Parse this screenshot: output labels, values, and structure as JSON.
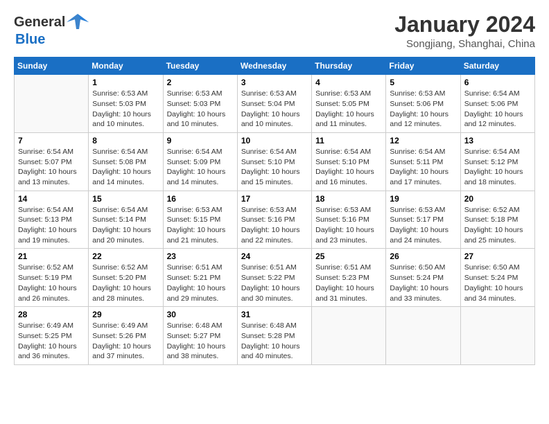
{
  "header": {
    "logo_general": "General",
    "logo_blue": "Blue",
    "month_title": "January 2024",
    "location": "Songjiang, Shanghai, China"
  },
  "days_of_week": [
    "Sunday",
    "Monday",
    "Tuesday",
    "Wednesday",
    "Thursday",
    "Friday",
    "Saturday"
  ],
  "weeks": [
    [
      {
        "day": "",
        "sunrise": "",
        "sunset": "",
        "daylight": ""
      },
      {
        "day": "1",
        "sunrise": "Sunrise: 6:53 AM",
        "sunset": "Sunset: 5:03 PM",
        "daylight": "Daylight: 10 hours and 10 minutes."
      },
      {
        "day": "2",
        "sunrise": "Sunrise: 6:53 AM",
        "sunset": "Sunset: 5:03 PM",
        "daylight": "Daylight: 10 hours and 10 minutes."
      },
      {
        "day": "3",
        "sunrise": "Sunrise: 6:53 AM",
        "sunset": "Sunset: 5:04 PM",
        "daylight": "Daylight: 10 hours and 10 minutes."
      },
      {
        "day": "4",
        "sunrise": "Sunrise: 6:53 AM",
        "sunset": "Sunset: 5:05 PM",
        "daylight": "Daylight: 10 hours and 11 minutes."
      },
      {
        "day": "5",
        "sunrise": "Sunrise: 6:53 AM",
        "sunset": "Sunset: 5:06 PM",
        "daylight": "Daylight: 10 hours and 12 minutes."
      },
      {
        "day": "6",
        "sunrise": "Sunrise: 6:54 AM",
        "sunset": "Sunset: 5:06 PM",
        "daylight": "Daylight: 10 hours and 12 minutes."
      }
    ],
    [
      {
        "day": "7",
        "sunrise": "Sunrise: 6:54 AM",
        "sunset": "Sunset: 5:07 PM",
        "daylight": "Daylight: 10 hours and 13 minutes."
      },
      {
        "day": "8",
        "sunrise": "Sunrise: 6:54 AM",
        "sunset": "Sunset: 5:08 PM",
        "daylight": "Daylight: 10 hours and 14 minutes."
      },
      {
        "day": "9",
        "sunrise": "Sunrise: 6:54 AM",
        "sunset": "Sunset: 5:09 PM",
        "daylight": "Daylight: 10 hours and 14 minutes."
      },
      {
        "day": "10",
        "sunrise": "Sunrise: 6:54 AM",
        "sunset": "Sunset: 5:10 PM",
        "daylight": "Daylight: 10 hours and 15 minutes."
      },
      {
        "day": "11",
        "sunrise": "Sunrise: 6:54 AM",
        "sunset": "Sunset: 5:10 PM",
        "daylight": "Daylight: 10 hours and 16 minutes."
      },
      {
        "day": "12",
        "sunrise": "Sunrise: 6:54 AM",
        "sunset": "Sunset: 5:11 PM",
        "daylight": "Daylight: 10 hours and 17 minutes."
      },
      {
        "day": "13",
        "sunrise": "Sunrise: 6:54 AM",
        "sunset": "Sunset: 5:12 PM",
        "daylight": "Daylight: 10 hours and 18 minutes."
      }
    ],
    [
      {
        "day": "14",
        "sunrise": "Sunrise: 6:54 AM",
        "sunset": "Sunset: 5:13 PM",
        "daylight": "Daylight: 10 hours and 19 minutes."
      },
      {
        "day": "15",
        "sunrise": "Sunrise: 6:54 AM",
        "sunset": "Sunset: 5:14 PM",
        "daylight": "Daylight: 10 hours and 20 minutes."
      },
      {
        "day": "16",
        "sunrise": "Sunrise: 6:53 AM",
        "sunset": "Sunset: 5:15 PM",
        "daylight": "Daylight: 10 hours and 21 minutes."
      },
      {
        "day": "17",
        "sunrise": "Sunrise: 6:53 AM",
        "sunset": "Sunset: 5:16 PM",
        "daylight": "Daylight: 10 hours and 22 minutes."
      },
      {
        "day": "18",
        "sunrise": "Sunrise: 6:53 AM",
        "sunset": "Sunset: 5:16 PM",
        "daylight": "Daylight: 10 hours and 23 minutes."
      },
      {
        "day": "19",
        "sunrise": "Sunrise: 6:53 AM",
        "sunset": "Sunset: 5:17 PM",
        "daylight": "Daylight: 10 hours and 24 minutes."
      },
      {
        "day": "20",
        "sunrise": "Sunrise: 6:52 AM",
        "sunset": "Sunset: 5:18 PM",
        "daylight": "Daylight: 10 hours and 25 minutes."
      }
    ],
    [
      {
        "day": "21",
        "sunrise": "Sunrise: 6:52 AM",
        "sunset": "Sunset: 5:19 PM",
        "daylight": "Daylight: 10 hours and 26 minutes."
      },
      {
        "day": "22",
        "sunrise": "Sunrise: 6:52 AM",
        "sunset": "Sunset: 5:20 PM",
        "daylight": "Daylight: 10 hours and 28 minutes."
      },
      {
        "day": "23",
        "sunrise": "Sunrise: 6:51 AM",
        "sunset": "Sunset: 5:21 PM",
        "daylight": "Daylight: 10 hours and 29 minutes."
      },
      {
        "day": "24",
        "sunrise": "Sunrise: 6:51 AM",
        "sunset": "Sunset: 5:22 PM",
        "daylight": "Daylight: 10 hours and 30 minutes."
      },
      {
        "day": "25",
        "sunrise": "Sunrise: 6:51 AM",
        "sunset": "Sunset: 5:23 PM",
        "daylight": "Daylight: 10 hours and 31 minutes."
      },
      {
        "day": "26",
        "sunrise": "Sunrise: 6:50 AM",
        "sunset": "Sunset: 5:24 PM",
        "daylight": "Daylight: 10 hours and 33 minutes."
      },
      {
        "day": "27",
        "sunrise": "Sunrise: 6:50 AM",
        "sunset": "Sunset: 5:24 PM",
        "daylight": "Daylight: 10 hours and 34 minutes."
      }
    ],
    [
      {
        "day": "28",
        "sunrise": "Sunrise: 6:49 AM",
        "sunset": "Sunset: 5:25 PM",
        "daylight": "Daylight: 10 hours and 36 minutes."
      },
      {
        "day": "29",
        "sunrise": "Sunrise: 6:49 AM",
        "sunset": "Sunset: 5:26 PM",
        "daylight": "Daylight: 10 hours and 37 minutes."
      },
      {
        "day": "30",
        "sunrise": "Sunrise: 6:48 AM",
        "sunset": "Sunset: 5:27 PM",
        "daylight": "Daylight: 10 hours and 38 minutes."
      },
      {
        "day": "31",
        "sunrise": "Sunrise: 6:48 AM",
        "sunset": "Sunset: 5:28 PM",
        "daylight": "Daylight: 10 hours and 40 minutes."
      },
      {
        "day": "",
        "sunrise": "",
        "sunset": "",
        "daylight": ""
      },
      {
        "day": "",
        "sunrise": "",
        "sunset": "",
        "daylight": ""
      },
      {
        "day": "",
        "sunrise": "",
        "sunset": "",
        "daylight": ""
      }
    ]
  ]
}
